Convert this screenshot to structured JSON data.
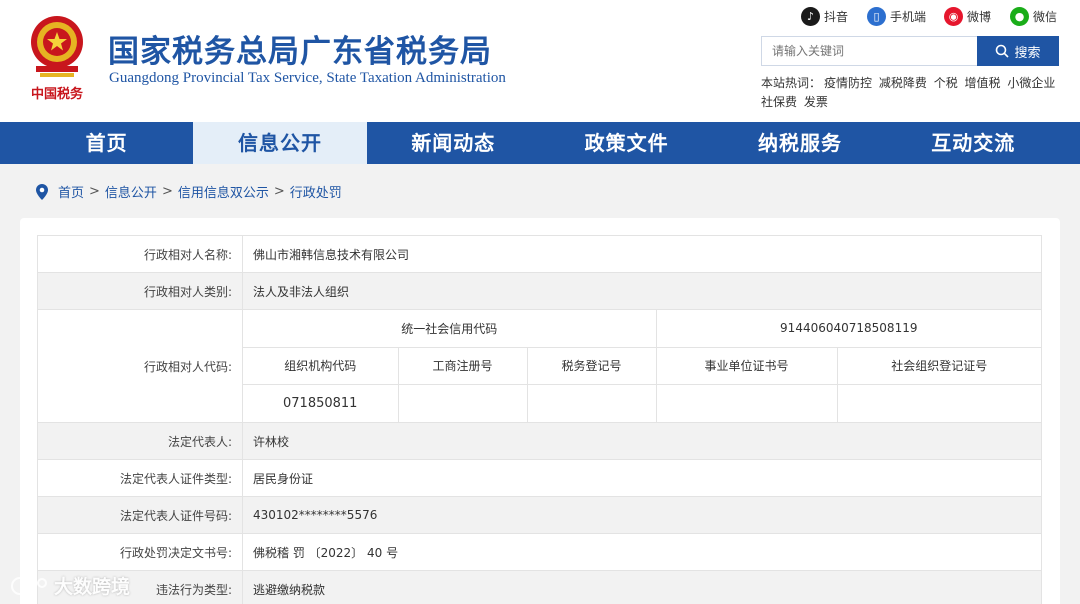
{
  "header": {
    "emblem_text": "中国税务",
    "title": "国家税务总局广东省税务局",
    "subtitle": "Guangdong Provincial Tax Service, State Taxation Administration",
    "social": [
      {
        "label": "抖音",
        "icon": "tiktok-icon"
      },
      {
        "label": "手机端",
        "icon": "mobile-icon"
      },
      {
        "label": "微博",
        "icon": "weibo-icon"
      },
      {
        "label": "微信",
        "icon": "wechat-icon"
      }
    ],
    "search_placeholder": "请输入关键词",
    "search_button": "搜索",
    "hot_label": "本站热词：",
    "hot_words": [
      "疫情防控",
      "减税降费",
      "个税",
      "增值税",
      "小微企业",
      "社保费",
      "发票"
    ]
  },
  "nav": {
    "items": [
      "首页",
      "信息公开",
      "新闻动态",
      "政策文件",
      "纳税服务",
      "互动交流"
    ],
    "active": "信息公开"
  },
  "breadcrumb": [
    "首页",
    "信用信息双公示",
    "行政处罚"
  ],
  "breadcrumb_home": "首页",
  "breadcrumb_mid": "信息公开",
  "record": {
    "name_label": "行政相对人名称:",
    "name": "佛山市湘韩信息技术有限公司",
    "type_label": "行政相对人类别:",
    "type": "法人及非法人组织",
    "code_label": "行政相对人代码:",
    "uscc_label": "统一社会信用代码",
    "uscc": "914406040718508119",
    "code_headers": [
      "组织机构代码",
      "工商注册号",
      "税务登记号",
      "事业单位证书号",
      "社会组织登记证号"
    ],
    "code_values": [
      "071850811",
      "",
      "",
      "",
      ""
    ],
    "legal_rep_label": "法定代表人:",
    "legal_rep": "许林校",
    "id_type_label": "法定代表人证件类型:",
    "id_type": "居民身份证",
    "id_no_label": "法定代表人证件号码:",
    "id_no": "430102********5576",
    "doc_no_label": "行政处罚决定文书号:",
    "doc_no": "佛税稽 罚 〔2022〕 40 号",
    "violation_label": "违法行为类型:",
    "violation": "逃避缴纳税款"
  },
  "watermark": "大数跨境"
}
